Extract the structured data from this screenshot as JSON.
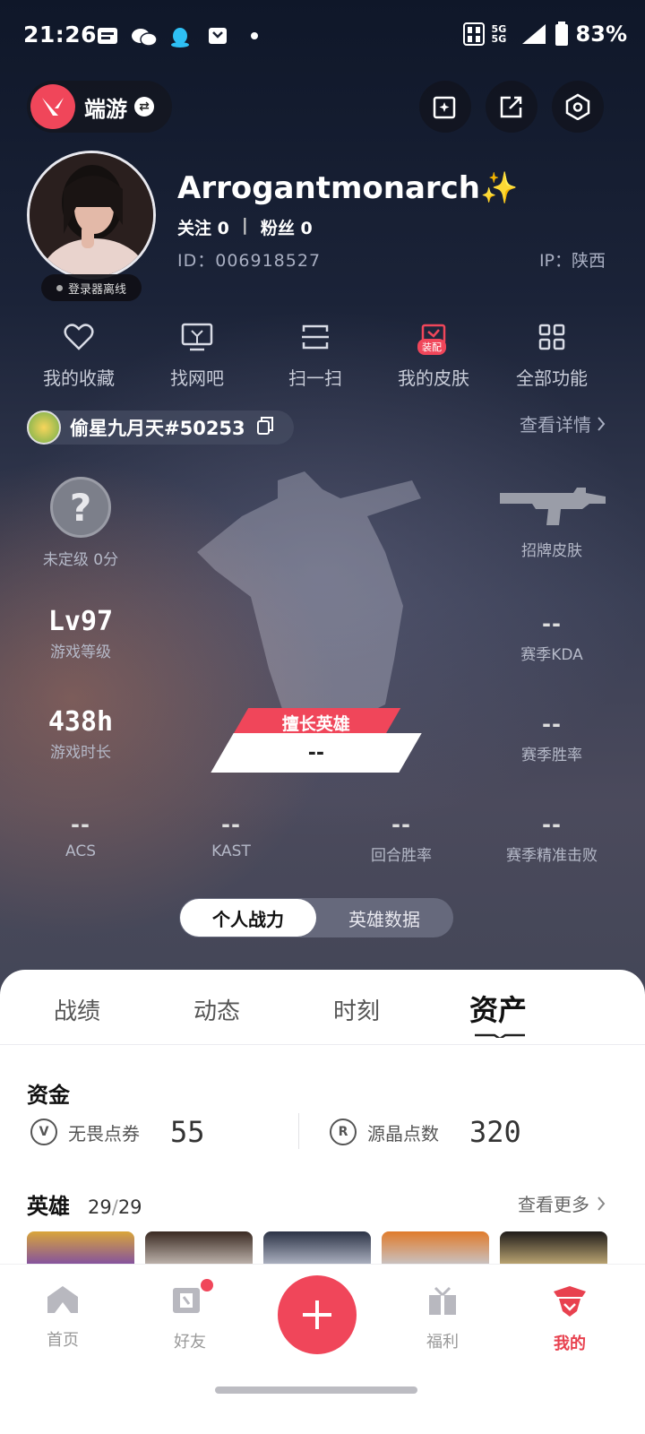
{
  "status_bar": {
    "time": "21:26",
    "network": "5G 5G",
    "battery": "83%"
  },
  "header": {
    "game_name": "端游"
  },
  "profile": {
    "username": "Arrogantmonarch✨",
    "follow_label": "关注",
    "follow_count": "0",
    "separator": "|",
    "fans_label": "粉丝",
    "fans_count": "0",
    "id_text": "ID：006918527",
    "ip_text": "IP：陕西",
    "online_status": "登录器离线"
  },
  "quick_actions": [
    {
      "label": "我的收藏",
      "icon": "heart-icon"
    },
    {
      "label": "找网吧",
      "icon": "monitor-icon"
    },
    {
      "label": "扫一扫",
      "icon": "scan-icon"
    },
    {
      "label": "我的皮肤",
      "icon": "skin-icon",
      "badge": "装配"
    },
    {
      "label": "全部功能",
      "icon": "grid-icon"
    }
  ],
  "riot": {
    "name": "偷星九月天#50253",
    "detail_link": "查看详情"
  },
  "stats": {
    "rank_label": "未定级 0分",
    "rank_symbol": "?",
    "skin_label": "招牌皮肤",
    "level_value": "Lv97",
    "level_label": "游戏等级",
    "kda_value": "--",
    "kda_label": "赛季KDA",
    "hours_value": "438h",
    "hours_label": "游戏时长",
    "winrate_value": "--",
    "winrate_label": "赛季胜率",
    "specialty_tag": "擅长英雄",
    "specialty_value": "--",
    "acs_value": "--",
    "acs_label": "ACS",
    "kast_value": "--",
    "kast_label": "KAST",
    "round_value": "--",
    "round_label": "回合胜率",
    "precision_value": "--",
    "precision_label": "赛季精准击败"
  },
  "toggle": {
    "active": "个人战力",
    "inactive": "英雄数据"
  },
  "tabs": [
    "战绩",
    "动态",
    "时刻",
    "资产"
  ],
  "funds": {
    "title": "资金",
    "vp_label": "无畏点券",
    "vp_value": "55",
    "rp_label": "源晶点数",
    "rp_value": "320"
  },
  "agents": {
    "title": "英雄",
    "owned": "29",
    "slash": "/",
    "total": "29",
    "more_link": "查看更多"
  },
  "bottom_nav": {
    "home": "首页",
    "friends": "好友",
    "welfare": "福利",
    "me": "我的"
  },
  "colors": {
    "accent": "#f0465a",
    "active_nav": "#e8414f"
  }
}
